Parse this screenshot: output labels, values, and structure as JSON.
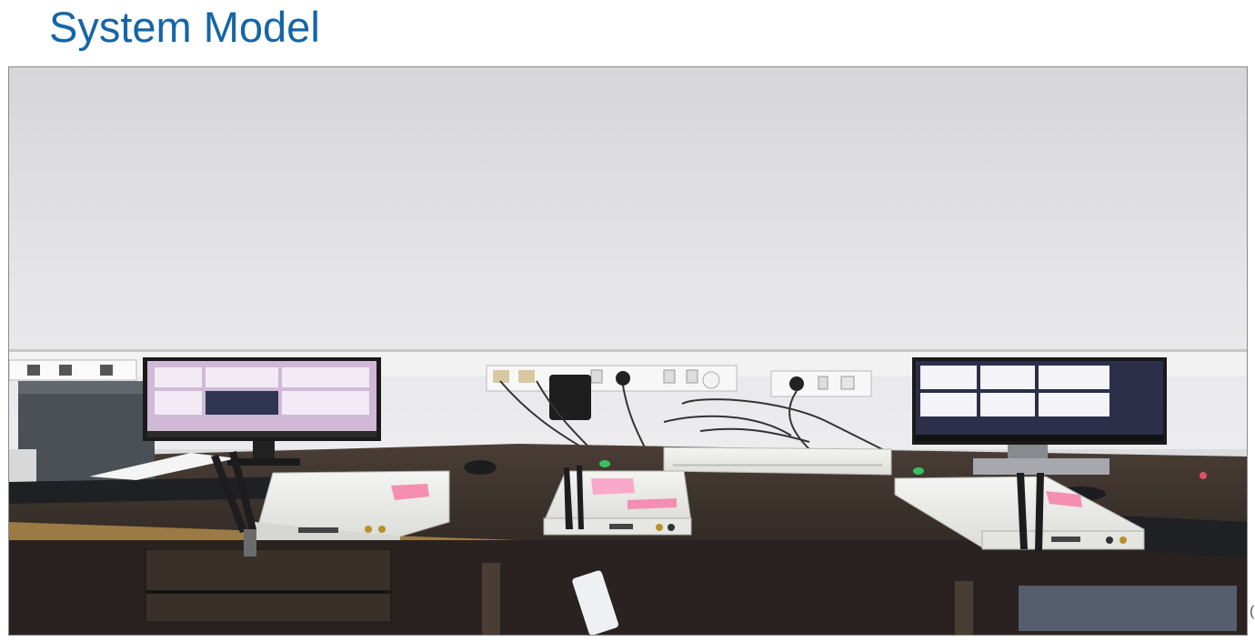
{
  "slide": {
    "title": "System Model",
    "edge_mark": "("
  },
  "photo": {
    "subject": "lab-bench-with-sdr-devices",
    "colors": {
      "wall": "#dedee2",
      "desk": "#3a302a",
      "desk_edge": "#8a6a3a",
      "device": "#ececea",
      "screen_bg": "#2a2430",
      "label_pink": "#f48fb1"
    }
  }
}
